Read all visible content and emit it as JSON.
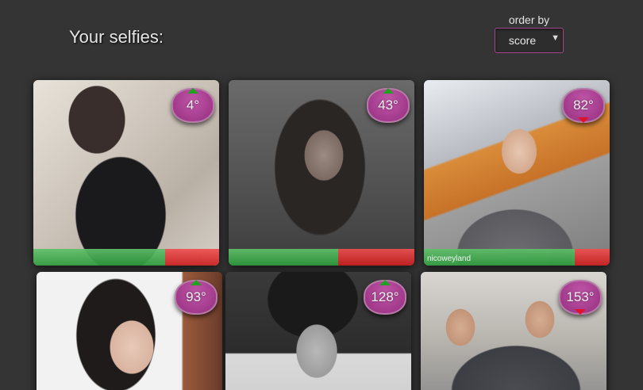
{
  "header": {
    "title": "Your selfies:",
    "order_label": "order by",
    "order_value": "score"
  },
  "colors": {
    "background": "#343434",
    "badge": "#a23a8c",
    "positive": "#2e9a3c",
    "negative": "#c81e1e"
  },
  "selfies": [
    {
      "degrees": "4°",
      "trend": "up",
      "positive_ratio": 0.71
    },
    {
      "degrees": "43°",
      "trend": "up",
      "positive_ratio": 0.59
    },
    {
      "degrees": "82°",
      "trend": "down",
      "positive_ratio": 0.81,
      "watermark": "nicoweyland"
    },
    {
      "degrees": "93°",
      "trend": "up"
    },
    {
      "degrees": "128°",
      "trend": "up"
    },
    {
      "degrees": "153°",
      "trend": "down"
    }
  ]
}
